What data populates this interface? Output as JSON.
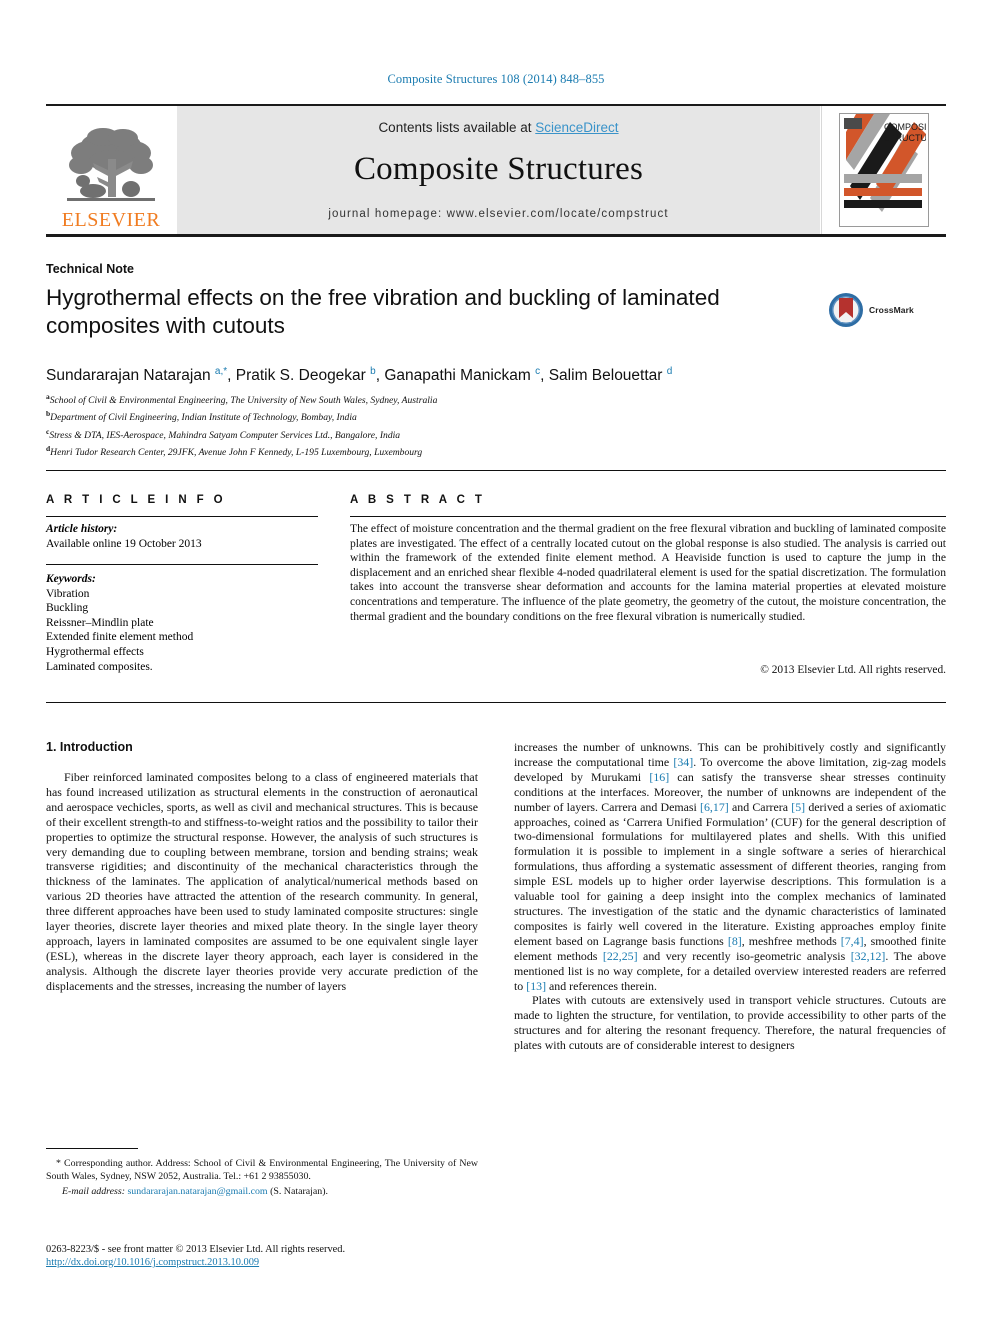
{
  "running_head": "Composite Structures 108 (2014) 848–855",
  "masthead": {
    "publisher_name": "ELSEVIER",
    "contents_prefix": "Contents lists available at ",
    "sciencedirect": "ScienceDirect",
    "journal_title": "Composite Structures",
    "homepage": "journal homepage: www.elsevier.com/locate/compstruct",
    "cover_title_line1": "COMPOSITE",
    "cover_title_line2": "STRUCTURES"
  },
  "article": {
    "type": "Technical Note",
    "title": "Hygrothermal effects on the free vibration and buckling of laminated composites with cutouts",
    "crossmark_label": "CrossMark",
    "authors_html": "Sundararajan Natarajan <sup>a,</sup><sup class=\"star\">*</sup>, Pratik S. Deogekar <sup>b</sup>, Ganapathi Manickam <sup>c</sup>, Salim Belouettar <sup>d</sup>",
    "affiliations": [
      {
        "marker": "a",
        "text": "School of Civil & Environmental Engineering, The University of New South Wales, Sydney, Australia"
      },
      {
        "marker": "b",
        "text": "Department of Civil Engineering, Indian Institute of Technology, Bombay, India"
      },
      {
        "marker": "c",
        "text": "Stress & DTA, IES-Aerospace, Mahindra Satyam Computer Services Ltd., Bangalore, India"
      },
      {
        "marker": "d",
        "text": "Henri Tudor Research Center, 29JFK, Avenue John F Kennedy, L-195 Luxembourg, Luxembourg"
      }
    ]
  },
  "info": {
    "heading": "A R T I C L E   I N F O",
    "history_label": "Article history:",
    "history_value": "Available online 19 October 2013",
    "keywords_label": "Keywords:",
    "keywords": [
      "Vibration",
      "Buckling",
      "Reissner–Mindlin plate",
      "Extended finite element method",
      "Hygrothermal effects",
      "Laminated composites."
    ]
  },
  "abstract": {
    "heading": "A B S T R A C T",
    "text": "The effect of moisture concentration and the thermal gradient on the free flexural vibration and buckling of laminated composite plates are investigated. The effect of a centrally located cutout on the global response is also studied. The analysis is carried out within the framework of the extended finite element method. A Heaviside function is used to capture the jump in the displacement and an enriched shear flexible 4-noded quadrilateral element is used for the spatial discretization. The formulation takes into account the transverse shear deformation and accounts for the lamina material properties at elevated moisture concentrations and temperature. The influence of the plate geometry, the geometry of the cutout, the moisture concentration, the thermal gradient and the boundary conditions on the free flexural vibration is numerically studied.",
    "copyright": "© 2013 Elsevier Ltd. All rights reserved."
  },
  "body": {
    "section_heading": "1. Introduction",
    "left_paragraph": "Fiber reinforced laminated composites belong to a class of engineered materials that has found increased utilization as structural elements in the construction of aeronautical and aerospace vechicles, sports, as well as civil and mechanical structures. This is because of their excellent strength-to and stiffness-to-weight ratios and the possibility to tailor their properties to optimize the structural response. However, the analysis of such structures is very demanding due to coupling between membrane, torsion and bending strains; weak transverse rigidities; and discontinuity of the mechanical characteristics through the thickness of the laminates. The application of analytical/numerical methods based on various 2D theories have attracted the attention of the research community. In general, three different approaches have been used to study laminated composite structures: single layer theories, discrete layer theories and mixed plate theory. In the single layer theory approach, layers in laminated composites are assumed to be one equivalent single layer (ESL), whereas in the discrete layer theory approach, each layer is considered in the analysis. Although the discrete layer theories provide very accurate prediction of the displacements and the stresses, increasing the number of layers",
    "right_paragraph_1_parts": [
      {
        "t": "increases the number of unknowns. This can be prohibitively costly and significantly increase the computational time "
      },
      {
        "t": "[34]",
        "cite": true
      },
      {
        "t": ". To overcome the above limitation, zig-zag models developed by Murukami "
      },
      {
        "t": "[16]",
        "cite": true
      },
      {
        "t": " can satisfy the transverse shear stresses continuity conditions at the interfaces. Moreover, the number of unknowns are independent of the number of layers. Carrera and Demasi "
      },
      {
        "t": "[6,17]",
        "cite": true
      },
      {
        "t": " and Carrera "
      },
      {
        "t": "[5]",
        "cite": true
      },
      {
        "t": " derived a series of axiomatic approaches, coined as ‘Carrera Unified Formulation’ (CUF) for the general description of two-dimensional formulations for multilayered plates and shells. With this unified formulation it is possible to implement in a single software a series of hierarchical formulations, thus affording a systematic assessment of different theories, ranging from simple ESL models up to higher order layerwise descriptions. This formulation is a valuable tool for gaining a deep insight into the complex mechanics of laminated structures. The investigation of the static and the dynamic characteristics of laminated composites is fairly well covered in the literature. Existing approaches employ finite element based on Lagrange basis functions "
      },
      {
        "t": "[8]",
        "cite": true
      },
      {
        "t": ", meshfree methods "
      },
      {
        "t": "[7,4]",
        "cite": true
      },
      {
        "t": ", smoothed finite element methods "
      },
      {
        "t": "[22,25]",
        "cite": true
      },
      {
        "t": " and very recently iso-geometric analysis "
      },
      {
        "t": "[32,12]",
        "cite": true
      },
      {
        "t": ". The above mentioned list is no way complete, for a detailed overview interested readers are referred to "
      },
      {
        "t": "[13]",
        "cite": true
      },
      {
        "t": " and references therein."
      }
    ],
    "right_paragraph_2": "Plates with cutouts are extensively used in transport vehicle structures. Cutouts are made to lighten the structure, for ventilation, to provide accessibility to other parts of the structures and for altering the resonant frequency. Therefore, the natural frequencies of plates with cutouts are of considerable interest to designers"
  },
  "footnotes": {
    "corresponding": "* Corresponding author. Address: School of Civil & Environmental Engineering, The University of New South Wales, Sydney, NSW 2052, Australia. Tel.: +61 2 93855030.",
    "email_label": "E-mail address:",
    "email": "sundararajan.natarajan@gmail.com",
    "email_suffix": "(S. Natarajan)."
  },
  "imprint": {
    "line1": "0263-8223/$ - see front matter © 2013 Elsevier Ltd. All rights reserved.",
    "doi": "http://dx.doi.org/10.1016/j.compstruct.2013.10.009"
  },
  "colors": {
    "accent_blue": "#1a7bb0",
    "elsevier_orange": "#f07c21",
    "masthead_gray": "#e6e6e6",
    "cover_orange": "#d2562a",
    "cover_gray": "#a5a5a5",
    "crossmark_blue": "#2e6da4",
    "crossmark_red": "#b5322e"
  }
}
